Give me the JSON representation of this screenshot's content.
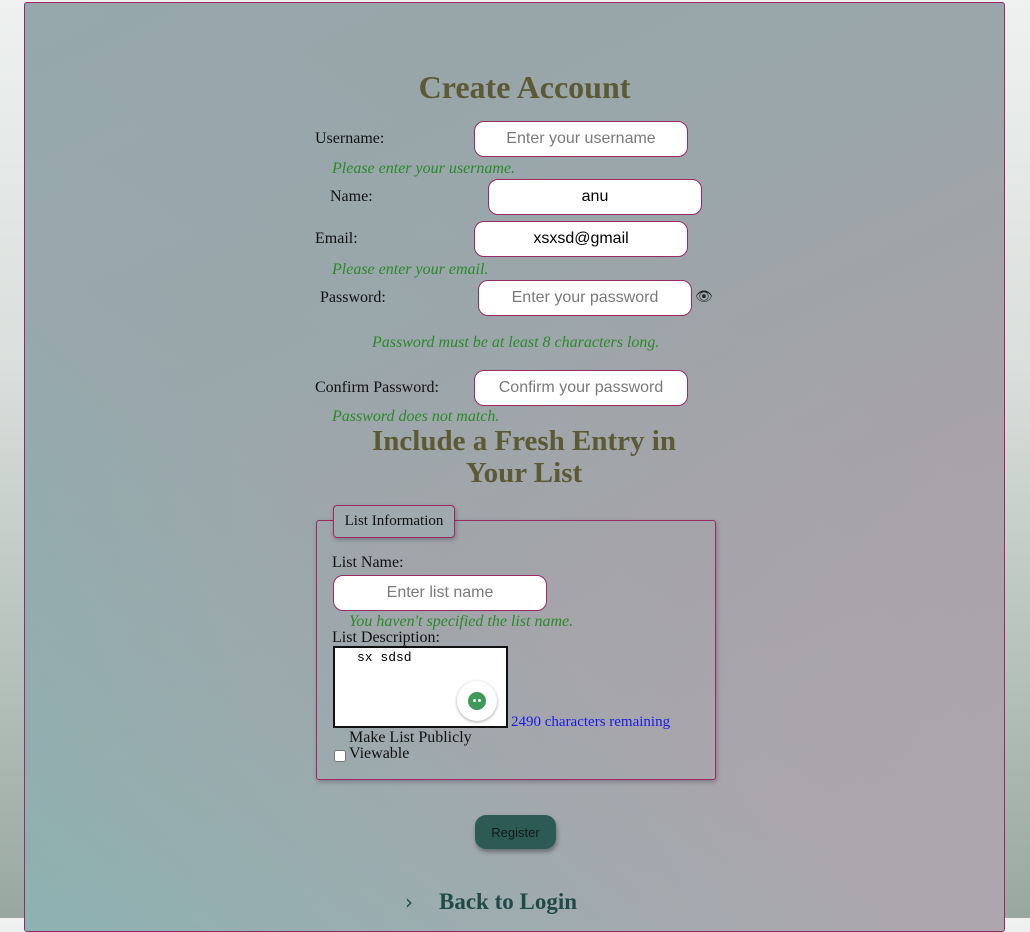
{
  "form": {
    "title": "Create Account",
    "username": {
      "label": "Username:",
      "placeholder": "Enter your username",
      "value": "",
      "error": "Please enter your username."
    },
    "name": {
      "label": "Name:",
      "placeholder": "",
      "value": "anu"
    },
    "email": {
      "label": "Email:",
      "placeholder": "",
      "value": "xsxsd@gmail",
      "error": "Please enter your email."
    },
    "password": {
      "label": "Password:",
      "placeholder": "Enter your password",
      "value": "",
      "toggle_icon": "eye-icon",
      "error": "Password must be at least 8 characters long."
    },
    "confirm_password": {
      "label": "Confirm Password:",
      "placeholder": "Confirm your password",
      "value": "",
      "error": "Password does not match."
    }
  },
  "list_section": {
    "title_line1": "Include a Fresh Entry in",
    "title_line2": "Your List",
    "legend": "List Information",
    "list_name": {
      "label": "List Name:",
      "placeholder": "Enter list name",
      "value": "",
      "error": "You haven't specified the list name."
    },
    "list_description": {
      "label": "List Description:",
      "value": "sx sdsd",
      "counter": "2490 characters remaining"
    },
    "public_checkbox": {
      "label_line1": "Make List Publicly",
      "label_line2": "Viewable",
      "checked": false
    }
  },
  "actions": {
    "register_label": "Register",
    "back_label": "Back to Login",
    "back_icon": "chevron-right-icon"
  },
  "colors": {
    "title": "#5c5a35",
    "hint": "#2a8a2a",
    "border_accent": "#9a2a63",
    "button_bg": "#2e5a55",
    "counter": "#1a1ae6"
  }
}
